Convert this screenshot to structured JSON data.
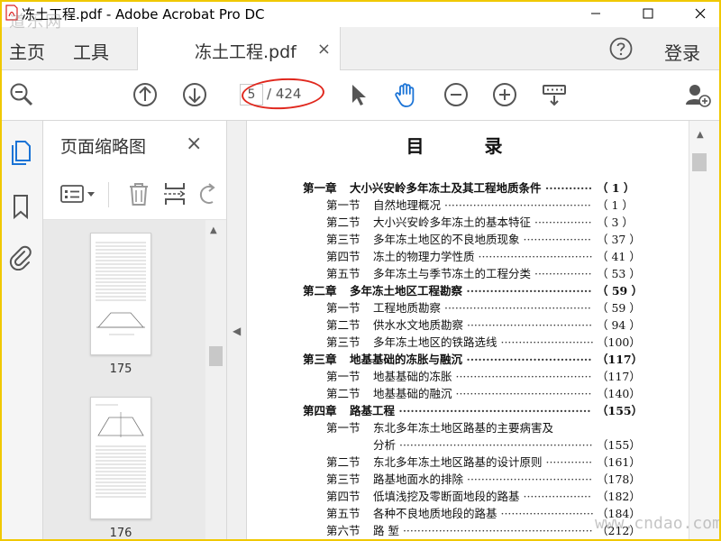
{
  "window": {
    "title": "冻土工程.pdf - Adobe Acrobat Pro DC",
    "watermark_top": "道乐网",
    "watermark_bottom": "www.cndao.com"
  },
  "tabbar": {
    "home": "主页",
    "tools": "工具",
    "doc_tab": "冻土工程.pdf",
    "close": "×",
    "login": "登录"
  },
  "toolbar": {
    "page_current": "5",
    "page_total": "/ 424"
  },
  "thumbnails": {
    "title": "页面缩略图",
    "close": "×",
    "pages": [
      {
        "number": "175"
      },
      {
        "number": "176"
      }
    ]
  },
  "toc": {
    "title": "目 录",
    "rows": [
      {
        "section": "第一章",
        "name": "大小兴安岭多年冻土及其工程地质条件",
        "page": "（ 1 ）",
        "chapter": true
      },
      {
        "section": "第一节",
        "name": "自然地理概况",
        "page": "（ 1 ）",
        "chapter": false
      },
      {
        "section": "第二节",
        "name": "大小兴安岭多年冻土的基本特征",
        "page": "（ 3 ）",
        "chapter": false
      },
      {
        "section": "第三节",
        "name": "多年冻土地区的不良地质现象",
        "page": "（ 37 ）",
        "chapter": false
      },
      {
        "section": "第四节",
        "name": "冻土的物理力学性质",
        "page": "（ 41 ）",
        "chapter": false
      },
      {
        "section": "第五节",
        "name": "多年冻土与季节冻土的工程分类",
        "page": "（ 53 ）",
        "chapter": false
      },
      {
        "section": "第二章",
        "name": "多年冻土地区工程勘察",
        "page": "（ 59 ）",
        "chapter": true
      },
      {
        "section": "第一节",
        "name": "工程地质勘察",
        "page": "（ 59 ）",
        "chapter": false
      },
      {
        "section": "第二节",
        "name": "供水水文地质勘察",
        "page": "（ 94 ）",
        "chapter": false
      },
      {
        "section": "第三节",
        "name": "多年冻土地区的铁路选线",
        "page": "（100）",
        "chapter": false
      },
      {
        "section": "第三章",
        "name": "地基基础的冻胀与融沉",
        "page": "（117）",
        "chapter": true
      },
      {
        "section": "第一节",
        "name": "地基基础的冻胀",
        "page": "（117）",
        "chapter": false
      },
      {
        "section": "第二节",
        "name": "地基基础的融沉",
        "page": "（140）",
        "chapter": false
      },
      {
        "section": "第四章",
        "name": "路基工程",
        "page": "（155）",
        "chapter": true
      },
      {
        "section": "第一节",
        "name": "东北多年冻土地区路基的主要病害及",
        "page": "",
        "chapter": false
      },
      {
        "section": "",
        "name": "分析",
        "page": "（155）",
        "chapter": false
      },
      {
        "section": "第二节",
        "name": "东北多年冻土地区路基的设计原则",
        "page": "（161）",
        "chapter": false
      },
      {
        "section": "第三节",
        "name": "路基地面水的排除",
        "page": "（178）",
        "chapter": false
      },
      {
        "section": "第四节",
        "name": "低填浅挖及零断面地段的路基",
        "page": "（182）",
        "chapter": false
      },
      {
        "section": "第五节",
        "name": "各种不良地质地段的路基",
        "page": "（184）",
        "chapter": false
      },
      {
        "section": "第六节",
        "name": "路 堑",
        "page": "（212）",
        "chapter": false
      }
    ]
  },
  "colors": {
    "accent_blue": "#1a73d6",
    "icon_gray": "#555555",
    "highlight_red": "#e0281e",
    "frame_yellow": "#f0c800"
  },
  "icons": {
    "search": "search-zoom-icon",
    "prev": "arrow-up-circle-icon",
    "next": "arrow-down-circle-icon",
    "select": "cursor-arrow-icon",
    "hand": "hand-tool-icon",
    "zoom_out": "minus-circle-icon",
    "zoom_in": "plus-circle-icon",
    "read_mode": "read-mode-icon",
    "share": "add-user-icon",
    "help": "help-icon",
    "pages": "page-thumbnails-icon",
    "bookmark": "bookmark-icon",
    "attachment": "paperclip-icon"
  }
}
